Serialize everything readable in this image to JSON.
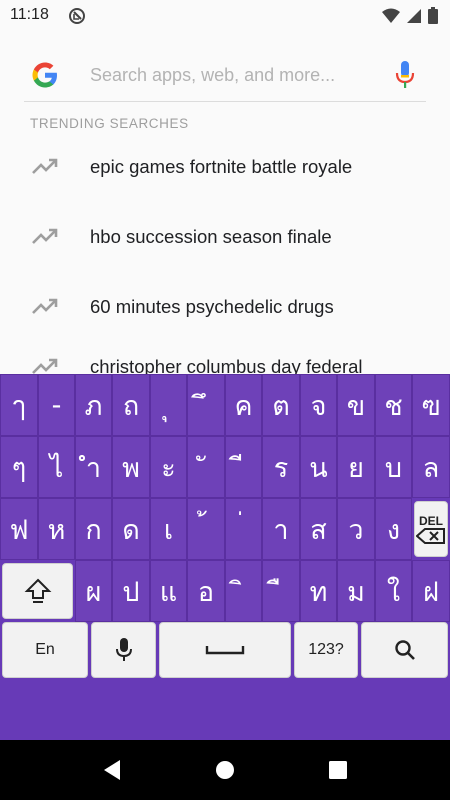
{
  "status": {
    "time": "11:18"
  },
  "search": {
    "placeholder": "Search apps, web, and more..."
  },
  "trending": {
    "header": "TRENDING SEARCHES",
    "items": [
      "epic games fortnite battle royale",
      "hbo succession season finale",
      "60 minutes psychedelic drugs",
      "christopher columbus day federal"
    ]
  },
  "keyboard": {
    "row1": [
      "ๅ",
      "-",
      "ภ",
      "ถ",
      "ุ",
      "ึ",
      "ค",
      "ต",
      "จ",
      "ข",
      "ช",
      "ฃ"
    ],
    "row2": [
      "ๆ",
      "ไ",
      "ำ",
      "พ",
      "ะ",
      "ั",
      "ี",
      "ร",
      "น",
      "ย",
      "บ",
      "ล"
    ],
    "row3": [
      "ฟ",
      "ห",
      "ก",
      "ด",
      "เ",
      "้",
      "่",
      "า",
      "ส",
      "ว",
      "ง"
    ],
    "row4": [
      "ผ",
      "ป",
      "แ",
      "อ",
      "ิ",
      "ื",
      "ท",
      "ม",
      "ใ",
      "ฝ"
    ],
    "del_label": "DEL",
    "lang_label": "En",
    "num_label": "123?"
  },
  "colors": {
    "keyboard_bg": "#673ab7",
    "key_bg": "#6e41b8",
    "accent_blue": "#4285f4"
  }
}
